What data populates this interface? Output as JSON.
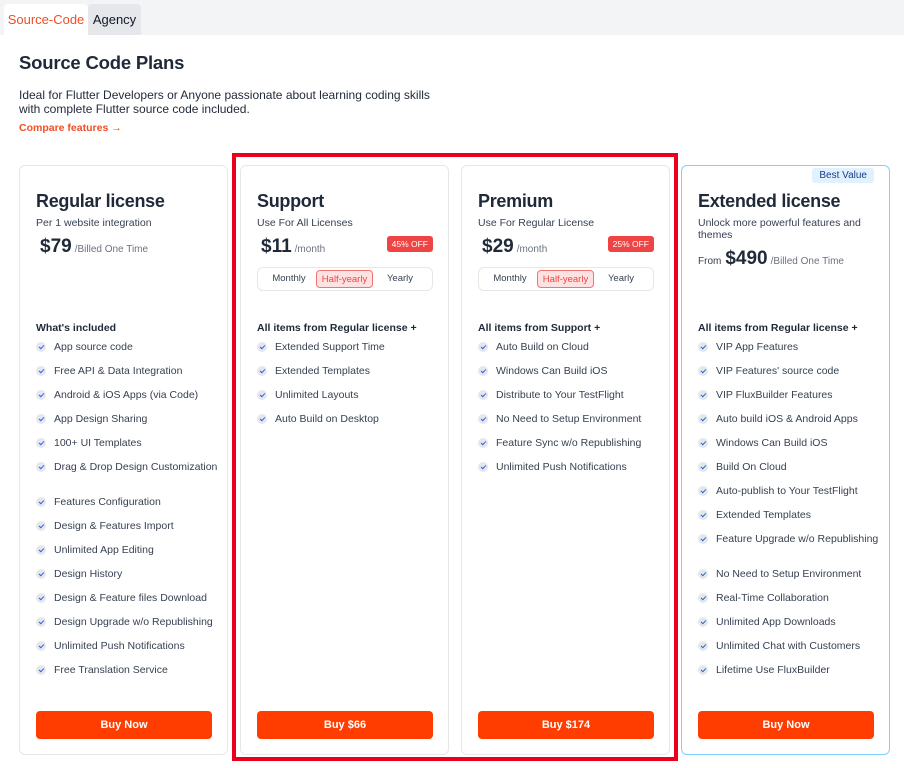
{
  "tabs": [
    {
      "label": "Source-Code",
      "active": true
    },
    {
      "label": "Agency",
      "active": false
    }
  ],
  "page": {
    "title": "Source Code Plans",
    "description": "Ideal for Flutter Developers or Anyone passionate about learning coding skills with complete Flutter source code included.",
    "compare_label": "Compare features",
    "compare_arrow": "→"
  },
  "colors": {
    "accent": "#f04e23",
    "buy_button": "#ff3d00",
    "discount_badge": "#ef4444",
    "check_icon": "#2563eb",
    "highlight_frame": "#e8001c",
    "best_value_border": "#7dd3fc"
  },
  "plans": [
    {
      "name": "Regular license",
      "subtitle": "Per 1 website integration",
      "price_prefix": "",
      "price": "$79",
      "price_unit": "/Billed One Time",
      "features_heading": "What's included",
      "features": [
        "App source code",
        "Free API & Data Integration",
        "Android & iOS Apps (via Code)",
        "App Design Sharing",
        "100+ UI Templates",
        "Drag & Drop Design Customization",
        "Features Configuration",
        "Design & Features Import",
        "Unlimited App Editing",
        "Design History",
        "Design & Feature files Download",
        "Design Upgrade w/o Republishing",
        "Unlimited Push Notifications",
        "Free Translation Service"
      ],
      "button_label": "Buy Now"
    },
    {
      "name": "Support",
      "subtitle": "Use For All Licenses",
      "price": "$11",
      "price_unit": "/month",
      "discount": "45% OFF",
      "periods": [
        "Monthly",
        "Half-yearly",
        "Yearly"
      ],
      "selected_period": "Half-yearly",
      "features_heading": "All items from Regular license +",
      "features": [
        "Extended Support Time",
        "Extended Templates",
        "Unlimited Layouts",
        "Auto Build on Desktop"
      ],
      "button_label": "Buy $66"
    },
    {
      "name": "Premium",
      "subtitle": "Use For Regular License",
      "price": "$29",
      "price_unit": "/month",
      "discount": "25% OFF",
      "periods": [
        "Monthly",
        "Half-yearly",
        "Yearly"
      ],
      "selected_period": "Half-yearly",
      "features_heading": "All items from Support +",
      "features": [
        "Auto Build on Cloud",
        "Windows Can Build iOS",
        "Distribute to Your TestFlight",
        "No Need to Setup Environment",
        "Feature Sync w/o Republishing",
        "Unlimited Push Notifications"
      ],
      "button_label": "Buy $174"
    },
    {
      "name": "Extended license",
      "badge": "Best Value",
      "subtitle": "Unlock more powerful features and themes",
      "price_prefix": "From",
      "price": "$490",
      "price_unit": "/Billed One Time",
      "features_heading": "All items from Regular license +",
      "features": [
        "VIP App Features",
        "VIP Features' source code",
        "VIP FluxBuilder Features",
        "Auto build iOS & Android Apps",
        "Windows Can Build iOS",
        "Build On Cloud",
        "Auto-publish to Your TestFlight",
        "Extended Templates",
        "Feature Upgrade w/o Republishing",
        "No Need to Setup Environment",
        "Real-Time Collaboration",
        "Unlimited App Downloads",
        "Unlimited Chat with Customers",
        "Lifetime Use FluxBuilder"
      ],
      "button_label": "Buy Now"
    }
  ]
}
